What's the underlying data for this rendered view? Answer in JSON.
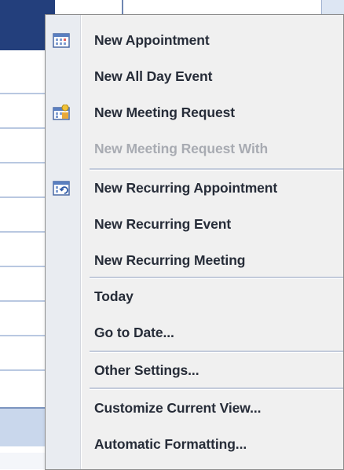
{
  "menu": {
    "items": [
      {
        "label": "New Appointment",
        "icon": "calendar-appointment-icon",
        "disabled": false
      },
      {
        "label": "New All Day Event",
        "icon": null,
        "disabled": false
      },
      {
        "label": "New Meeting Request",
        "icon": "meeting-request-icon",
        "disabled": false
      },
      {
        "label": "New Meeting Request With",
        "icon": null,
        "disabled": true
      },
      {
        "label": "New Recurring Appointment",
        "icon": "recurring-appointment-icon",
        "disabled": false
      },
      {
        "label": "New Recurring Event",
        "icon": null,
        "disabled": false
      },
      {
        "label": "New Recurring Meeting",
        "icon": null,
        "disabled": false
      },
      {
        "label": "Today",
        "icon": null,
        "disabled": false
      },
      {
        "label": "Go to Date...",
        "icon": null,
        "disabled": false
      },
      {
        "label": "Other Settings...",
        "icon": null,
        "disabled": false
      },
      {
        "label": "Customize Current View...",
        "icon": null,
        "disabled": false
      },
      {
        "label": "Automatic Formatting...",
        "icon": null,
        "disabled": false
      }
    ]
  },
  "colors": {
    "menu_background": "#f0f0f0",
    "gutter": "#e9ecf1",
    "text": "#262c38",
    "disabled_text": "#a8abb2",
    "separator": "#c3cbdb",
    "window_accent": "#233f7c"
  }
}
